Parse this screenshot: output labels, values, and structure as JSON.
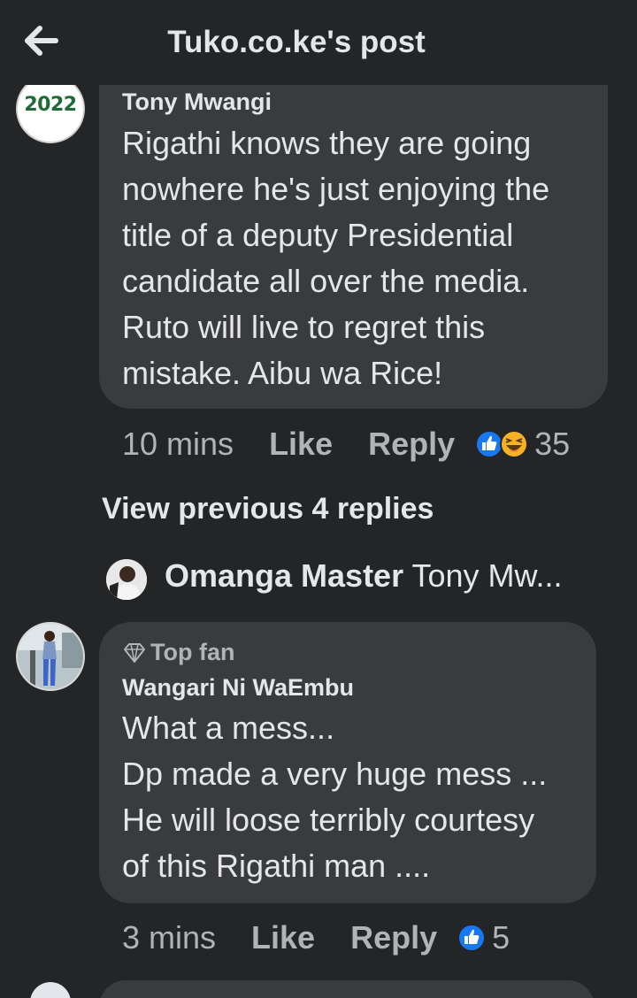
{
  "header": {
    "title": "Tuko.co.ke's post",
    "back_icon": "arrow-left-icon"
  },
  "comments": [
    {
      "avatar_text": "2022",
      "author": "Tony Mwangi",
      "text": "Rigathi knows they are going\nnowhere he's just enjoying the\ntitle of a deputy Presidential\ncandidate all over the media.\nRuto will live to regret this\nmistake. Aibu wa Rice!",
      "time": "10 mins",
      "like_label": "Like",
      "reply_label": "Reply",
      "reaction_icons": [
        "like-reaction-icon",
        "haha-reaction-icon"
      ],
      "reaction_count": "35"
    },
    {
      "badge": "Top fan",
      "badge_icon": "diamond-icon",
      "author": "Wangari Ni WaEmbu",
      "text": "What a mess...\nDp made a very huge mess ...\nHe will loose terribly courtesy\nof this Rigathi man ....",
      "time": "3 mins",
      "like_label": "Like",
      "reply_label": "Reply",
      "reaction_icons": [
        "like-reaction-icon"
      ],
      "reaction_count": "5"
    }
  ],
  "view_previous": "View previous 4 replies",
  "reply_preview": {
    "name": "Omanga Master",
    "text": "Tony Mw..."
  },
  "colors": {
    "background": "#242526",
    "bubble": "#3a3b3c",
    "primary_text": "#e4e6eb",
    "secondary_text": "#b0b3b8",
    "like_blue": "#1877f2",
    "haha_yellow": "#f7b125"
  }
}
